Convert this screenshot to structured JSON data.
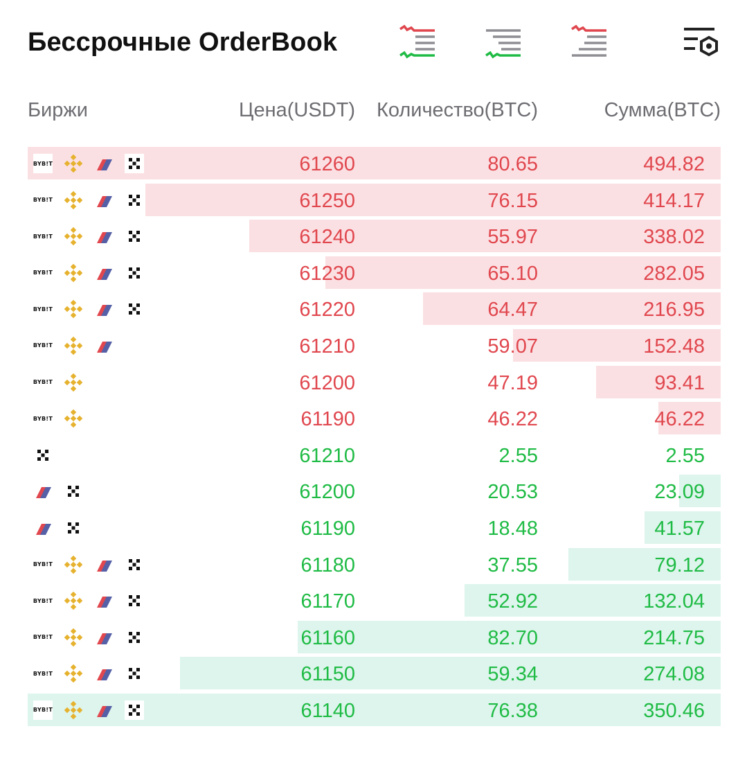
{
  "header": {
    "title": "Бессрочные OrderBook",
    "icons": [
      "orderbook-both-icon",
      "orderbook-bids-icon",
      "orderbook-asks-icon",
      "settings-icon"
    ]
  },
  "columns": {
    "exchanges": "Биржи",
    "price": "Цена(USDT)",
    "quantity": "Количество(BTC)",
    "sum": "Сумма(BTC)"
  },
  "colors": {
    "ask": "#e0474e",
    "bid": "#1fbb45",
    "ask_depth": "#fbe0e3",
    "bid_depth": "#ddf5ec"
  },
  "exchange_labels": {
    "bybit": "BYB!T"
  },
  "asks": [
    {
      "exchanges": [
        "bybit",
        "binance",
        "bitmex",
        "okx"
      ],
      "price": "61260",
      "qty": "80.65",
      "sum": "494.82",
      "depth": 1.0
    },
    {
      "exchanges": [
        "bybit",
        "binance",
        "bitmex",
        "okx"
      ],
      "price": "61250",
      "qty": "76.15",
      "sum": "414.17",
      "depth": 0.83
    },
    {
      "exchanges": [
        "bybit",
        "binance",
        "bitmex",
        "okx"
      ],
      "price": "61240",
      "qty": "55.97",
      "sum": "338.02",
      "depth": 0.68
    },
    {
      "exchanges": [
        "bybit",
        "binance",
        "bitmex",
        "okx"
      ],
      "price": "61230",
      "qty": "65.10",
      "sum": "282.05",
      "depth": 0.57
    },
    {
      "exchanges": [
        "bybit",
        "binance",
        "bitmex",
        "okx"
      ],
      "price": "61220",
      "qty": "64.47",
      "sum": "216.95",
      "depth": 0.43
    },
    {
      "exchanges": [
        "bybit",
        "binance",
        "bitmex"
      ],
      "price": "61210",
      "qty": "59.07",
      "sum": "152.48",
      "depth": 0.3
    },
    {
      "exchanges": [
        "bybit",
        "binance"
      ],
      "price": "61200",
      "qty": "47.19",
      "sum": "93.41",
      "depth": 0.18
    },
    {
      "exchanges": [
        "bybit",
        "binance"
      ],
      "price": "61190",
      "qty": "46.22",
      "sum": "46.22",
      "depth": 0.09
    }
  ],
  "bids": [
    {
      "exchanges": [
        "okx"
      ],
      "price": "61210",
      "qty": "2.55",
      "sum": "2.55",
      "depth": 0.0
    },
    {
      "exchanges": [
        "bitmex",
        "okx"
      ],
      "price": "61200",
      "qty": "20.53",
      "sum": "23.09",
      "depth": 0.06
    },
    {
      "exchanges": [
        "bitmex",
        "okx"
      ],
      "price": "61190",
      "qty": "18.48",
      "sum": "41.57",
      "depth": 0.11
    },
    {
      "exchanges": [
        "bybit",
        "binance",
        "bitmex",
        "okx"
      ],
      "price": "61180",
      "qty": "37.55",
      "sum": "79.12",
      "depth": 0.22
    },
    {
      "exchanges": [
        "bybit",
        "binance",
        "bitmex",
        "okx"
      ],
      "price": "61170",
      "qty": "52.92",
      "sum": "132.04",
      "depth": 0.37
    },
    {
      "exchanges": [
        "bybit",
        "binance",
        "bitmex",
        "okx"
      ],
      "price": "61160",
      "qty": "82.70",
      "sum": "214.75",
      "depth": 0.61
    },
    {
      "exchanges": [
        "bybit",
        "binance",
        "bitmex",
        "okx"
      ],
      "price": "61150",
      "qty": "59.34",
      "sum": "274.08",
      "depth": 0.78
    },
    {
      "exchanges": [
        "bybit",
        "binance",
        "bitmex",
        "okx"
      ],
      "price": "61140",
      "qty": "76.38",
      "sum": "350.46",
      "depth": 1.0
    }
  ]
}
